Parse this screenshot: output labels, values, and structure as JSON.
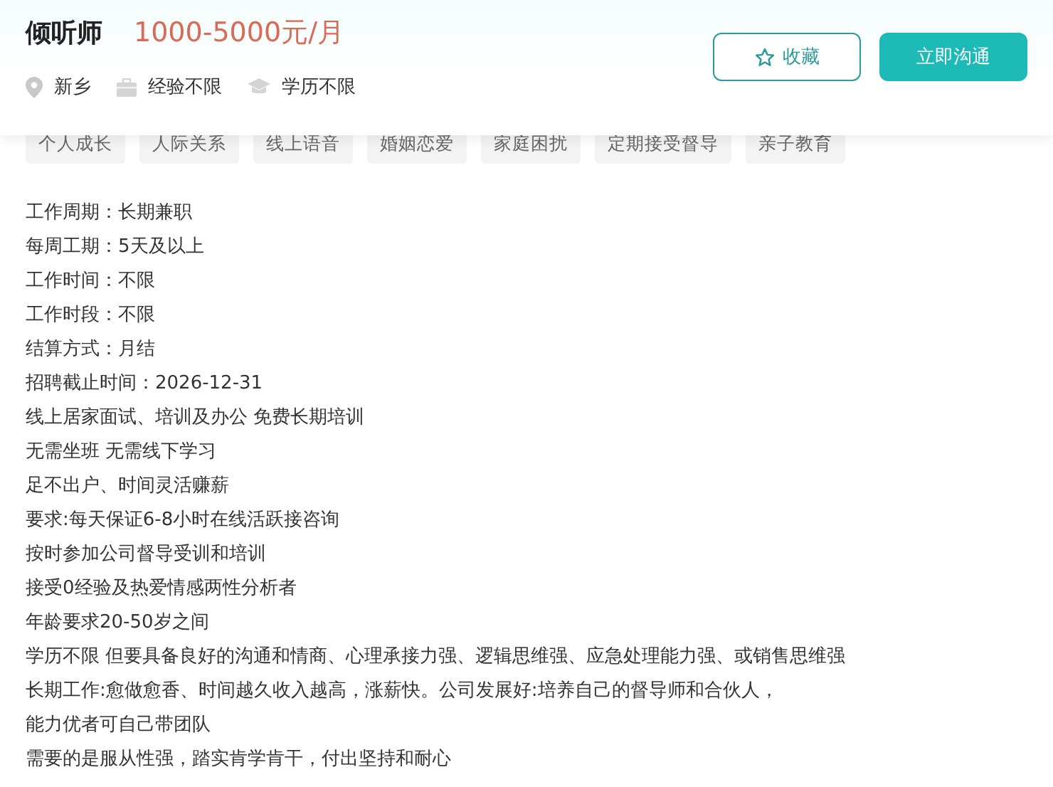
{
  "job": {
    "title": "倾听师",
    "salary": "1000-5000元/月",
    "location": "新乡",
    "experience": "经验不限",
    "education": "学历不限"
  },
  "buttons": {
    "favorite": "收藏",
    "chat": "立即沟通"
  },
  "tags": [
    "个人成长",
    "人际关系",
    "线上语音",
    "婚姻恋爱",
    "家庭困扰",
    "定期接受督导",
    "亲子教育"
  ],
  "description": [
    "工作周期：长期兼职",
    "每周工期：5天及以上",
    "工作时间：不限",
    "工作时段：不限",
    "结算方式：月结",
    "招聘截止时间：2026-12-31",
    "线上居家面试、培训及办公 免费长期培训",
    "无需坐班 无需线下学习",
    "足不出户、时间灵活赚薪",
    "要求:每天保证6-8小时在线活跃接咨询",
    "按时参加公司督导受训和培训",
    "接受0经验及热爱情感两性分析者",
    "年龄要求20-50岁之间",
    "学历不限 但要具备良好的沟通和情商、心理承接力强、逻辑思维强、应急处理能力强、或销售思维强",
    "长期工作:愈做愈香、时间越久收入越高，涨薪快。公司发展好:培养自己的督导师和合伙人，",
    "能力优者可自己带团队",
    "需要的是服从性强，踏实肯学肯干，付出坚持和耐心"
  ]
}
